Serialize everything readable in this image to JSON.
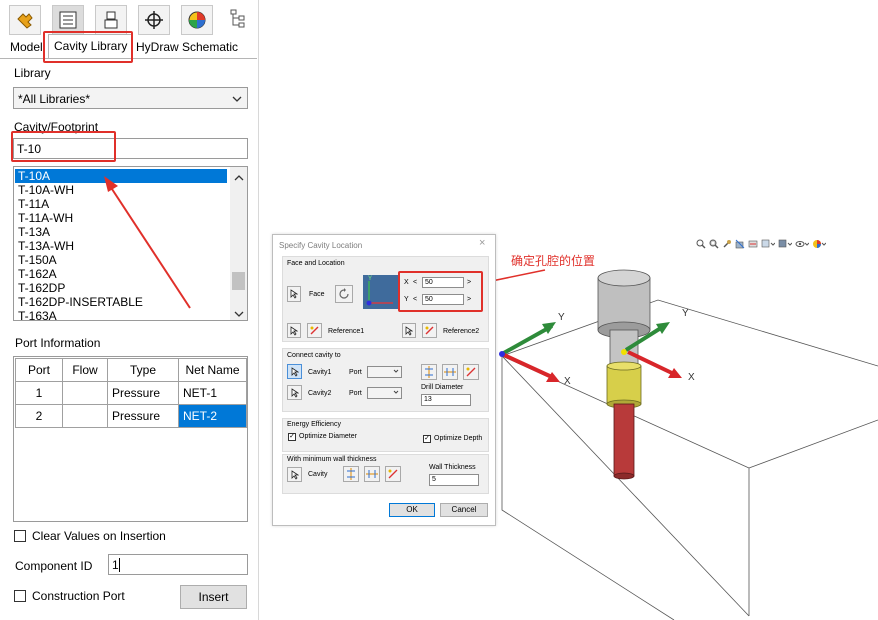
{
  "left_panel": {
    "toolbar_icons": [
      "puzzle-icon",
      "property-manager-icon",
      "configuration-icon",
      "crosshair-icon",
      "appearance-icon",
      "tree-icon"
    ],
    "tabs": [
      {
        "label": "Model"
      },
      {
        "label": "Cavity Library"
      },
      {
        "label": "HyDraw Schematic"
      }
    ],
    "library_label": "Library",
    "library_value": "*All Libraries*",
    "cavity_label": "Cavity/Footprint",
    "cavity_value": "T-10",
    "list_items": [
      "T-10A",
      "T-10A-WH",
      "T-11A",
      "T-11A-WH",
      "T-13A",
      "T-13A-WH",
      "T-150A",
      "T-162A",
      "T-162DP",
      "T-162DP-INSERTABLE",
      "T-163A"
    ],
    "selected_item": "T-10A",
    "port_info_label": "Port Information",
    "port_table": {
      "headers": [
        "Port",
        "Flow",
        "Type",
        "Net Name"
      ],
      "rows": [
        {
          "port": "1",
          "flow": "",
          "type": "Pressure",
          "net": "NET-1"
        },
        {
          "port": "2",
          "flow": "",
          "type": "Pressure",
          "net": "NET-2"
        }
      ]
    },
    "clear_values_label": "Clear Values on Insertion",
    "component_id_label": "Component ID",
    "component_id_value": "1",
    "construction_port_label": "Construction Port",
    "insert_button": "Insert"
  },
  "dialog": {
    "title": "Specify Cavity Location",
    "close": "×",
    "face_location_label": "Face and Location",
    "face_label": "Face",
    "x_label": "X",
    "y_label": "Y",
    "less": "<",
    "greater": ">",
    "x_value": "50",
    "y_value": "50",
    "reference1_label": "Reference1",
    "reference2_label": "Reference2",
    "connect_label": "Connect cavity to",
    "cavity1_label": "Cavity1",
    "cavity2_label": "Cavity2",
    "port_label": "Port",
    "drill_diameter_label": "Drill Diameter",
    "drill_diameter_value": "13",
    "energy_label": "Energy Efficiency",
    "optimize_diameter_label": "Optimize Diameter",
    "optimize_depth_label": "Optimize Depth",
    "min_wall_label": "With minimum wall thickness",
    "cavity_label": "Cavity",
    "wall_thickness_label": "Wall Thickness",
    "wall_thickness_value": "5",
    "ok_button": "OK",
    "cancel_button": "Cancel"
  },
  "annotation": {
    "text": "确定孔腔的位置"
  },
  "viewport": {
    "axis_y": "Y",
    "axis_x": "X",
    "axis_y2": "Y",
    "axis_x2": "X",
    "toolbar_icons": [
      "zoom-fit-icon",
      "zoom-area-icon",
      "previous-view-icon",
      "section-view-icon",
      "dynamic-annotation-icon",
      "view-orientation-icon",
      "display-style-icon",
      "hide-show-icon",
      "appearance-icon"
    ]
  },
  "colors": {
    "accent_red": "#e0302a",
    "selection_blue": "#0078d7",
    "axis_green": "#2e8b3a",
    "axis_red": "#d8262a",
    "cavity_yellow": "#d7cf4a",
    "drill_red": "#b83a3a"
  }
}
